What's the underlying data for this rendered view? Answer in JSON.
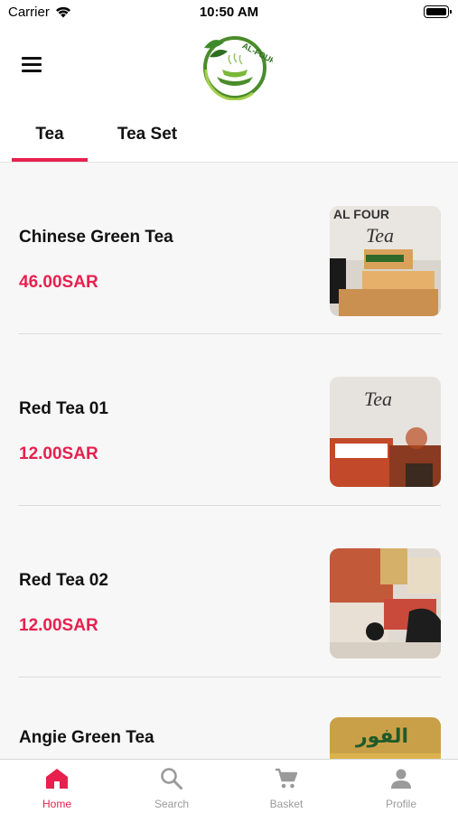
{
  "status_bar": {
    "carrier": "Carrier",
    "time": "10:50 AM"
  },
  "header": {
    "logo_text": "AL-FOUR"
  },
  "tabs": [
    {
      "label": "Tea",
      "active": true
    },
    {
      "label": "Tea Set",
      "active": false
    }
  ],
  "products": [
    {
      "name": "Chinese Green Tea",
      "price": "46.00SAR",
      "image_text": "AL FOUR\nTea"
    },
    {
      "name": "Red Tea 01",
      "price": "12.00SAR",
      "image_text": "Tea"
    },
    {
      "name": "Red Tea 02",
      "price": "12.00SAR",
      "image_text": ""
    },
    {
      "name": "Angie Green Tea",
      "price": "",
      "image_text": "الفور"
    }
  ],
  "bottom_nav": [
    {
      "label": "Home",
      "icon": "home-icon",
      "active": true
    },
    {
      "label": "Search",
      "icon": "search-icon",
      "active": false
    },
    {
      "label": "Basket",
      "icon": "cart-icon",
      "active": false
    },
    {
      "label": "Profile",
      "icon": "profile-icon",
      "active": false
    }
  ],
  "colors": {
    "accent": "#e8204e",
    "inactive": "#9a9a9a",
    "background": "#f7f7f7"
  }
}
